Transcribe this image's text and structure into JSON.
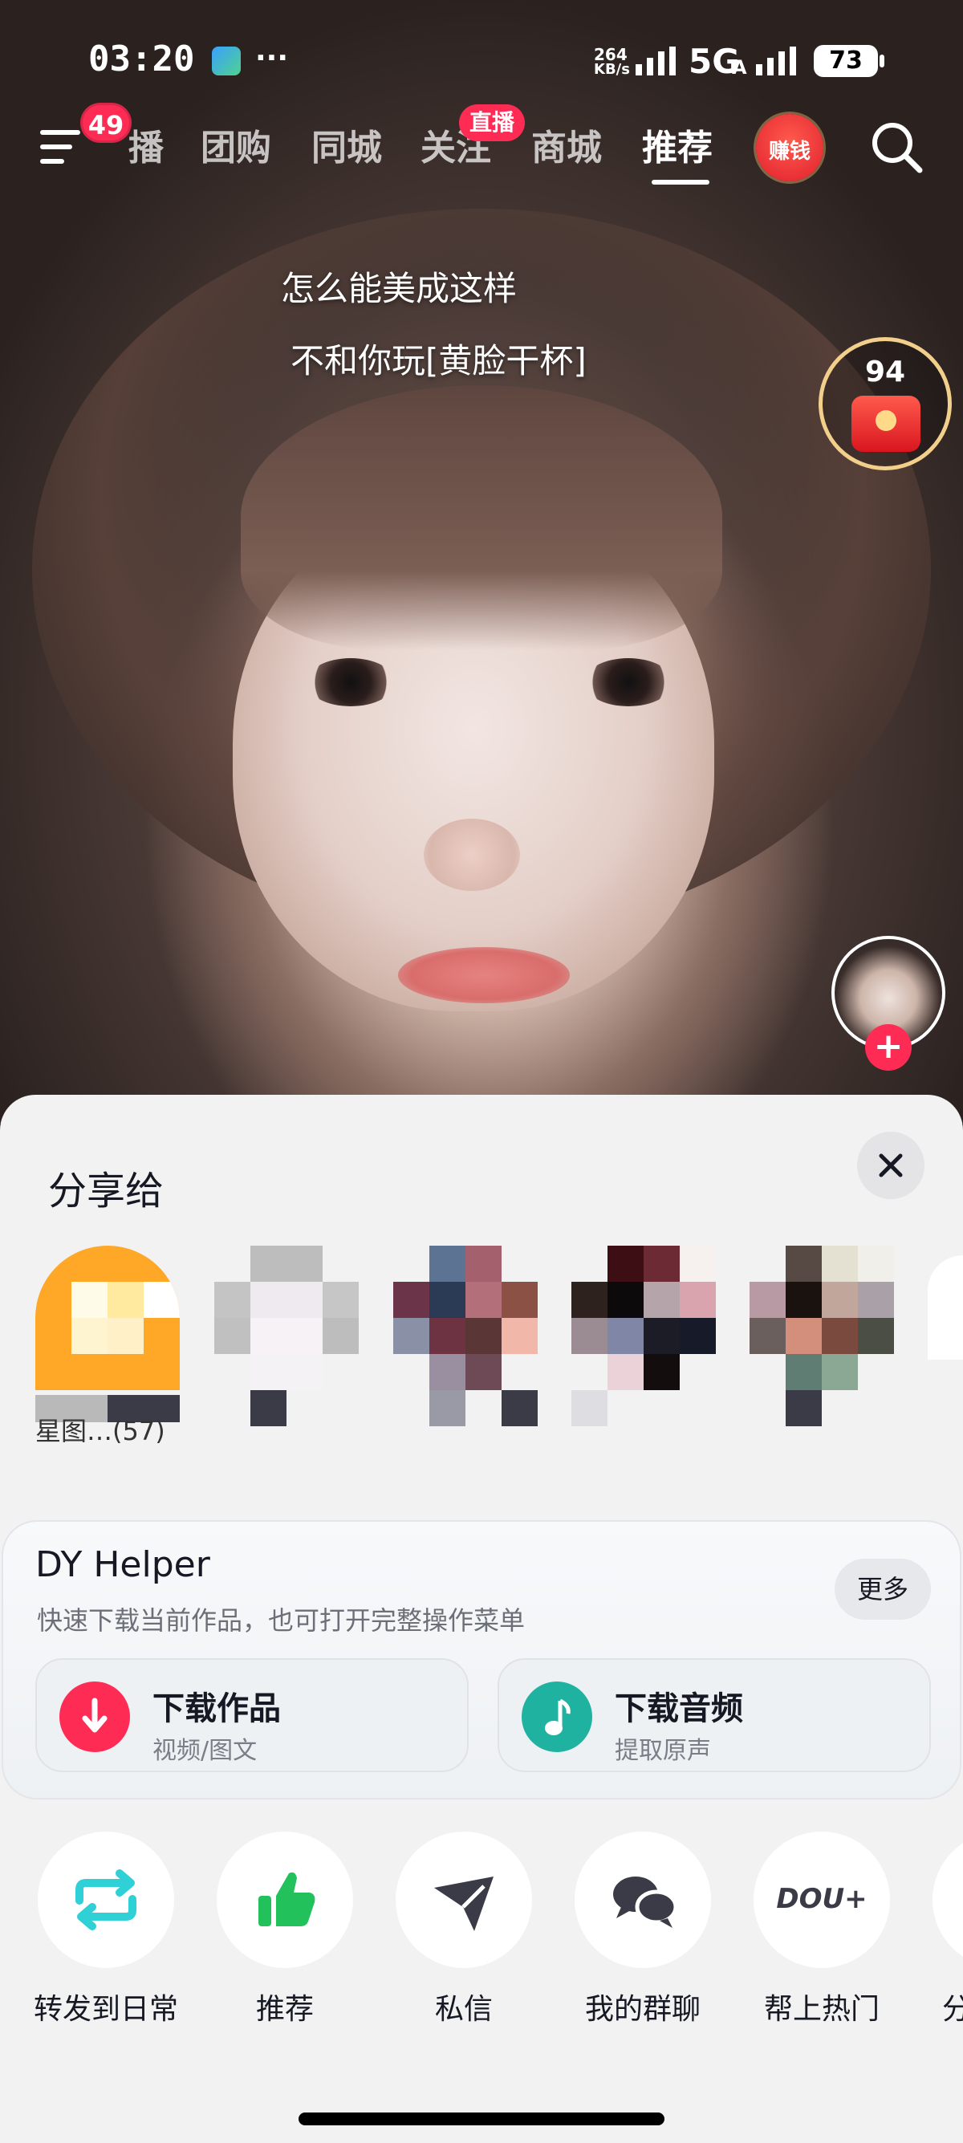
{
  "status_bar": {
    "time": "03:20",
    "dots": "···",
    "speed_top": "264",
    "speed_bottom": "KB/s",
    "network": "5G",
    "network_sub": "A",
    "battery": "73"
  },
  "nav": {
    "menu_badge": "49",
    "tabs": [
      {
        "label": "播"
      },
      {
        "label": "团购"
      },
      {
        "label": "同城"
      },
      {
        "label": "关注",
        "badge": "直播"
      },
      {
        "label": "商城"
      },
      {
        "label": "推荐"
      }
    ],
    "earn_label": "赚钱"
  },
  "video": {
    "caption_line1": "怎么能美成这样",
    "caption_line2": "不和你玩[黄脸干杯]",
    "reward_count": "94",
    "follow_plus": "+"
  },
  "share_sheet": {
    "title": "分享给",
    "contacts": [
      {
        "name": "星图…(57)"
      },
      {
        "name": ""
      },
      {
        "name": ""
      },
      {
        "name": ""
      },
      {
        "name": ""
      }
    ],
    "helper": {
      "title": "DY Helper",
      "subtitle": "快速下载当前作品，也可打开完整操作菜单",
      "more_label": "更多",
      "buttons": [
        {
          "label": "下载作品",
          "sub": "视频/图文",
          "icon": "download-arrow-icon",
          "color": "#fe2c55"
        },
        {
          "label": "下载音频",
          "sub": "提取原声",
          "icon": "music-note-icon",
          "color": "#20b2a0"
        }
      ]
    },
    "actions": [
      {
        "label": "转发到日常",
        "icon": "repost-icon"
      },
      {
        "label": "推荐",
        "icon": "thumbs-up-icon"
      },
      {
        "label": "私信",
        "icon": "paper-plane-icon"
      },
      {
        "label": "我的群聊",
        "icon": "group-chat-icon"
      },
      {
        "label": "帮上热门",
        "icon": "dou-plus-icon",
        "icon_text": "DOU+"
      },
      {
        "label": "分",
        "icon": "share-more-icon"
      }
    ]
  },
  "colors": {
    "accent": "#fe2c55",
    "teal": "#20b2a0",
    "green": "#23c15c"
  }
}
